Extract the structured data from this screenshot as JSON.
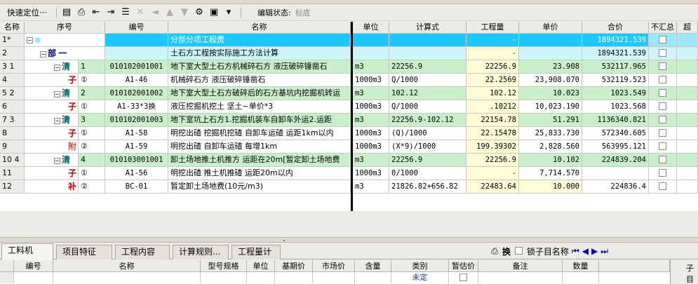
{
  "toolbar": {
    "quick_locate": "快速定位···",
    "edit_state_label": "编辑状态:",
    "edit_state_value": "标底"
  },
  "grid": {
    "headers": [
      "名称",
      "序号",
      "编号",
      "名称",
      "单位",
      "计算式",
      "工程量",
      "单价",
      "合价",
      "不汇总",
      "超"
    ],
    "rows": [
      {
        "no": "1*",
        "seq": "",
        "code": "",
        "name": "分部分项工程费",
        "unit": "",
        "formula": "",
        "qty": "-",
        "price": "",
        "total": "1894321.539"
      },
      {
        "no": "2",
        "kind": "部",
        "seq": "一",
        "code": "",
        "name": "土石方工程按实际施工方法计算",
        "unit": "",
        "formula": "",
        "qty": "-",
        "price": "",
        "total": "1894321.539"
      },
      {
        "no": "3 1",
        "kind": "清",
        "seq": "1",
        "code": "010102001001",
        "name": "地下室大型土石方机械碎石方 液压破碎锤凿石",
        "unit": "m3",
        "formula": "22256.9",
        "qty": "22256.9",
        "price": "23.908",
        "total": "532117.965"
      },
      {
        "no": "4",
        "kind": "子",
        "seq": "①",
        "code": "A1-46",
        "name": "机械碎石方 液压破碎锤凿石",
        "unit": "1000m3",
        "formula": "Q/1000",
        "qty": "22.2569",
        "price": "23,908.070",
        "total": "532119.523"
      },
      {
        "no": "5 2",
        "kind": "清",
        "seq": "2",
        "code": "010102001002",
        "name": "地下室大型土石方破碎后的石方基坑内挖掘机转运",
        "unit": "m3",
        "formula": "102.12",
        "qty": "102.12",
        "price": "10.023",
        "total": "1023.549"
      },
      {
        "no": "6",
        "kind": "子",
        "seq": "①",
        "code": "A1-33*3换",
        "name": "液压挖掘机挖土 坚土~单价*3",
        "unit": "1000m3",
        "formula": "Q/1000",
        "qty": ".10212",
        "price": "10,023.190",
        "total": "1023.568"
      },
      {
        "no": "7 3",
        "kind": "清",
        "seq": "3",
        "code": "010102001003",
        "name": "地下室坑上石方1.挖掘机装车自卸车外运2.运距",
        "unit": "m3",
        "formula": "22256.9-102.12",
        "qty": "22154.78",
        "price": "51.291",
        "total": "1136340.821"
      },
      {
        "no": "8",
        "kind": "子",
        "seq": "①",
        "code": "A1-58",
        "name": "明挖出碴 挖掘机挖碴 自卸车运碴 运距1km以内",
        "unit": "1000m3",
        "formula": "(Q)/1000",
        "qty": "22.15478",
        "price": "25,833.730",
        "total": "572340.605"
      },
      {
        "no": "9",
        "kind": "附",
        "seq": "②",
        "code": "A1-59",
        "name": "明挖出碴 自卸车运碴 每增1km",
        "unit": "1000m3",
        "formula": "(X*9)/1000",
        "qty": "199.39302",
        "price": "2,828.560",
        "total": "563995.121"
      },
      {
        "no": "10 4",
        "kind": "清",
        "seq": "4",
        "code": "010103001001",
        "name": "卸土场地推土机推方 运距在20m[暂定卸土场地费",
        "unit": "m3",
        "formula": "22256.9",
        "qty": "22256.9",
        "price": "10.102",
        "total": "224839.204"
      },
      {
        "no": "11",
        "kind": "子",
        "seq": "①",
        "code": "A1-56",
        "name": "明挖出碴 推土机推碴 运距20m以内",
        "unit": "1000m3",
        "formula": "0/1000",
        "qty": "-",
        "price": "7,714.570",
        "total": ""
      },
      {
        "no": "12",
        "kind": "补",
        "seq": "②",
        "code": "BC-01",
        "name": "暂定卸土场地费(10元/m3)",
        "unit": "m3",
        "formula": "21826.82+656.82",
        "qty": "22483.64",
        "price": "10.000",
        "total": "224836.4"
      }
    ]
  },
  "tabs": [
    "工料机",
    "项目特征",
    "工程内容",
    "计算规则...",
    "工程量计算"
  ],
  "tab_tools": {
    "lock_label": "锁子目名称",
    "swap_label": "换"
  },
  "lower": {
    "headers": [
      "编号",
      "名称",
      "型号规格",
      "单位",
      "基期价",
      "市场价",
      "含量",
      "类别",
      "暂估价",
      "备注",
      "数量"
    ],
    "row": {
      "category": "未定"
    },
    "right_header": "子目"
  }
}
